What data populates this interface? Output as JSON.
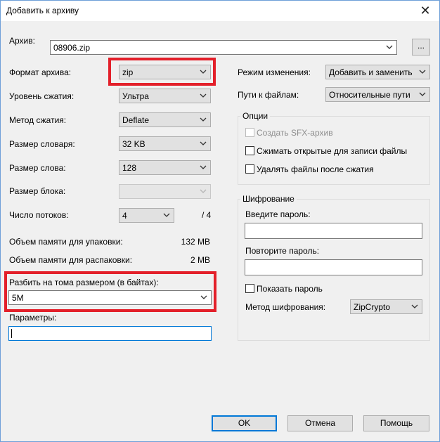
{
  "window": {
    "title": "Добавить к архиву",
    "close_symbol": "✕"
  },
  "archive": {
    "label": "Архив:",
    "value": "08906.zip",
    "browse_label": "..."
  },
  "left": {
    "format": {
      "label": "Формат архива:",
      "value": "zip"
    },
    "level": {
      "label": "Уровень сжатия:",
      "value": "Ультра"
    },
    "method": {
      "label": "Метод сжатия:",
      "value": "Deflate"
    },
    "dict": {
      "label": "Размер словаря:",
      "value": "32 KB"
    },
    "word": {
      "label": "Размер слова:",
      "value": "128"
    },
    "block": {
      "label": "Размер блока:",
      "value": ""
    },
    "threads": {
      "label": "Число потоков:",
      "value": "4",
      "total": "/ 4"
    },
    "mem_pack": {
      "label": "Объем памяти для упаковки:",
      "value": "132 MB"
    },
    "mem_unpack": {
      "label": "Объем памяти для распаковки:",
      "value": "2 MB"
    },
    "split": {
      "label": "Разбить на тома размером (в байтах):",
      "value": "5M"
    },
    "params": {
      "label": "Параметры:",
      "value": ""
    }
  },
  "right": {
    "update_mode": {
      "label": "Режим изменения:",
      "value": "Добавить и заменить"
    },
    "path_mode": {
      "label": "Пути к файлам:",
      "value": "Относительные пути"
    },
    "options": {
      "title": "Опции",
      "sfx": "Создать SFX-архив",
      "shared": "Сжимать открытые для записи файлы",
      "delete": "Удалять файлы после сжатия"
    },
    "encryption": {
      "title": "Шифрование",
      "password_label": "Введите пароль:",
      "repeat_label": "Повторите пароль:",
      "show_label": "Показать пароль",
      "method_label": "Метод шифрования:",
      "method_value": "ZipCrypto"
    }
  },
  "buttons": {
    "ok": "OK",
    "cancel": "Отмена",
    "help": "Помощь"
  },
  "colors": {
    "highlight": "#e3202a",
    "default_button_border": "#0078d7"
  }
}
